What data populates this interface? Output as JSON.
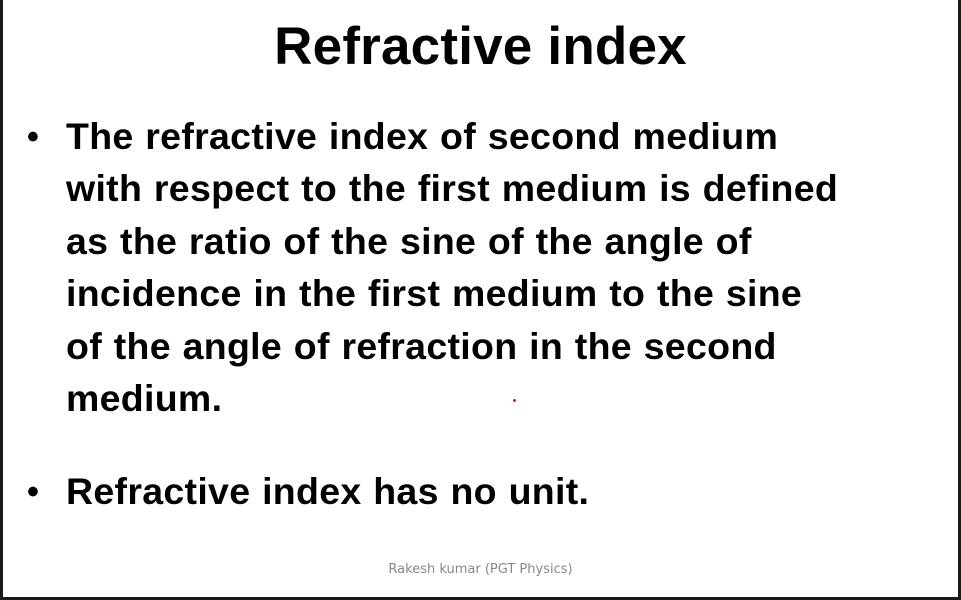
{
  "slide": {
    "title": "Refractive index",
    "bullets": [
      {
        "marker": "•",
        "lines": [
          "The refractive index of second medium",
          "with respect to the first medium is defined",
          "as the ratio of the sine of the angle of",
          "incidence in the first medium to the sine",
          "of the angle of refraction in the second",
          "medium."
        ]
      },
      {
        "marker": "•",
        "lines": [
          "Refractive index has no unit."
        ]
      }
    ],
    "footer": "Rakesh kumar (PGT Physics)",
    "laser_pointer_color": "#d42020"
  }
}
